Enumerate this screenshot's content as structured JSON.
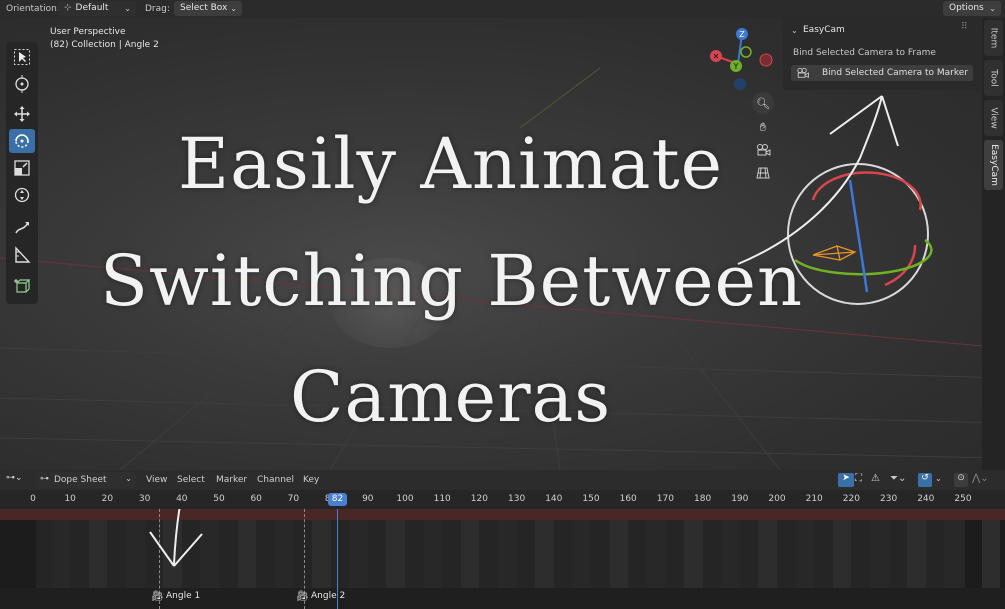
{
  "topbar": {
    "orientation_label": "Orientation:",
    "orientation_value": "Default",
    "drag_label": "Drag:",
    "drag_value": "Select Box",
    "options_label": "Options"
  },
  "viewport": {
    "view_name": "User Perspective",
    "collection_info": "(82) Collection | Angle 2",
    "gizmo": {
      "z": "Z",
      "y": "Y"
    }
  },
  "npanel": {
    "section_title": "EasyCam",
    "bind_frame_label": "Bind Selected Camera to Frame",
    "bind_marker_button": "Bind Selected Camera to Marker",
    "tabs": [
      "Item",
      "Tool",
      "View",
      "EasyCam"
    ]
  },
  "headline": {
    "line1": "Easily Animate",
    "line2": "Switching Between",
    "line3": "Cameras"
  },
  "dopesheet": {
    "editor_label": "Dope Sheet",
    "menus": [
      "View",
      "Select",
      "Marker",
      "Channel",
      "Key"
    ],
    "current_frame": "82",
    "ticks": [
      "0",
      "10",
      "20",
      "30",
      "40",
      "50",
      "60",
      "70",
      "80",
      "90",
      "100",
      "110",
      "120",
      "130",
      "140",
      "150",
      "160",
      "170",
      "180",
      "190",
      "200",
      "210",
      "220",
      "230",
      "240",
      "250"
    ],
    "markers": [
      "Angle 1",
      "Angle 2"
    ]
  },
  "colors": {
    "active_tool": "#3b6fa8",
    "x_axis": "#d9444f",
    "y_axis": "#6fb026",
    "z_axis": "#3b78d8",
    "playhead": "#4a7fd1"
  }
}
